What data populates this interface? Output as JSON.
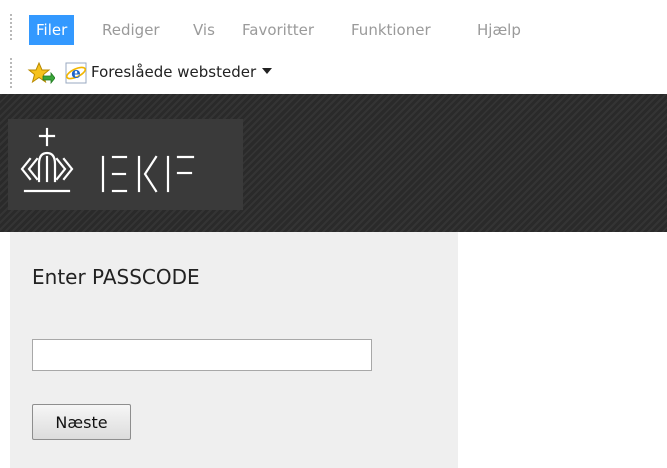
{
  "menubar": {
    "items": [
      "Filer",
      "Rediger",
      "Vis",
      "Favoritter",
      "Funktioner",
      "Hjælp"
    ],
    "active_index": 0
  },
  "favorites_bar": {
    "suggested_sites": "Foreslåede websteder"
  },
  "brand": {
    "logo_text": "EKF"
  },
  "form": {
    "title": "Enter PASSCODE",
    "passcode_value": "",
    "next_label": "Næste"
  },
  "colors": {
    "menu_active_bg": "#3399ff",
    "banner_bg": "#2e2e2e",
    "panel_bg": "#efefef",
    "logo_stroke": "#ffffff"
  },
  "icons": {
    "favorites": "favorites-star-icon",
    "ie": "ie-e-icon",
    "dropdown": "caret-down-icon",
    "crown": "crown-icon"
  }
}
